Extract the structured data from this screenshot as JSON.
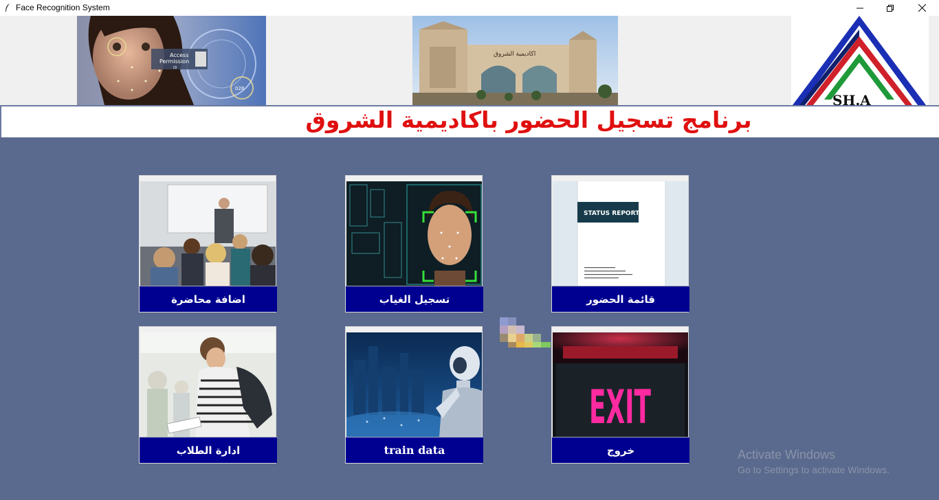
{
  "window": {
    "title": "Face Recognition System",
    "controls": {
      "minimize": "minimize-icon",
      "restore": "restore-icon",
      "close": "close-icon"
    }
  },
  "header": {
    "heading": "برنامج تسجيل الحضور باكاديمية الشروق",
    "face_image_text": [
      "Access",
      "Permission",
      "ID",
      "028"
    ],
    "gate_sign": "اكاديمية الشروق",
    "logo_text": "SH.A"
  },
  "tiles": [
    {
      "id": "add-lecture",
      "label": "اضافة محاضرة"
    },
    {
      "id": "record-absence",
      "label": "تسجيل الغياب"
    },
    {
      "id": "attendance-list",
      "label": "قائمة الحضور",
      "report_title": "STATUS REPORT"
    },
    {
      "id": "manage-students",
      "label": "ادارة الطلاب"
    },
    {
      "id": "train-data",
      "label": "train data"
    },
    {
      "id": "exit",
      "label": "خروج",
      "sign_text": "EXIT"
    }
  ],
  "watermark": {
    "line1": "Activate Windows",
    "line2": "Go to Settings to activate Windows."
  },
  "colors": {
    "background": "#5a6a8e",
    "tile_label_bg": "#000090",
    "heading_text": "#e01010"
  }
}
